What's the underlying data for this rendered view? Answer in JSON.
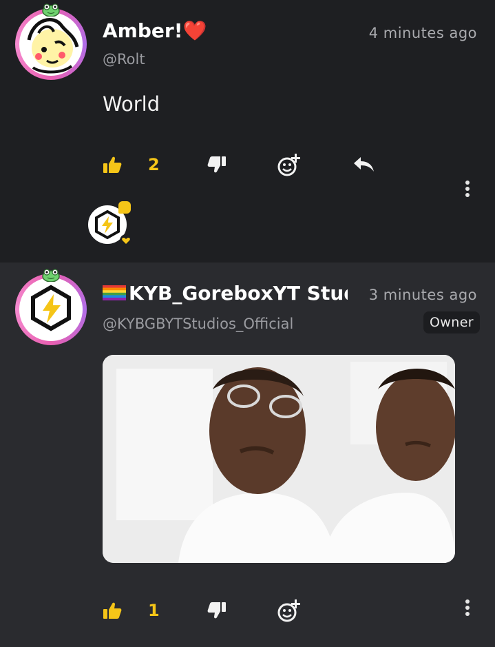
{
  "comments": [
    {
      "display_name": "Amber!",
      "name_emoji": "❤️",
      "handle": "@Rolt",
      "time": "4 minutes ago",
      "text": "World",
      "likes": "2",
      "icons": {
        "like": "thumbs-up-icon",
        "dislike": "thumbs-down-icon",
        "react": "add-reaction-icon",
        "reply": "reply-icon",
        "more": "more-vertical-icon"
      }
    },
    {
      "display_name": "KYB_GoreboxYT Studios",
      "name_prefix_emoji": "🏳️‍🌈",
      "handle": "@KYBGBYTStudios_Official",
      "time": "3 minutes ago",
      "badge": "Owner",
      "likes": "1",
      "icons": {
        "like": "thumbs-up-icon",
        "dislike": "thumbs-down-icon",
        "react": "add-reaction-icon",
        "more": "more-vertical-icon"
      }
    }
  ],
  "colors": {
    "background_top": "#1e1f22",
    "background_bottom": "#2a2b2f",
    "accent_yellow": "#f5c518",
    "avatar_ring": "#e85fb0"
  }
}
